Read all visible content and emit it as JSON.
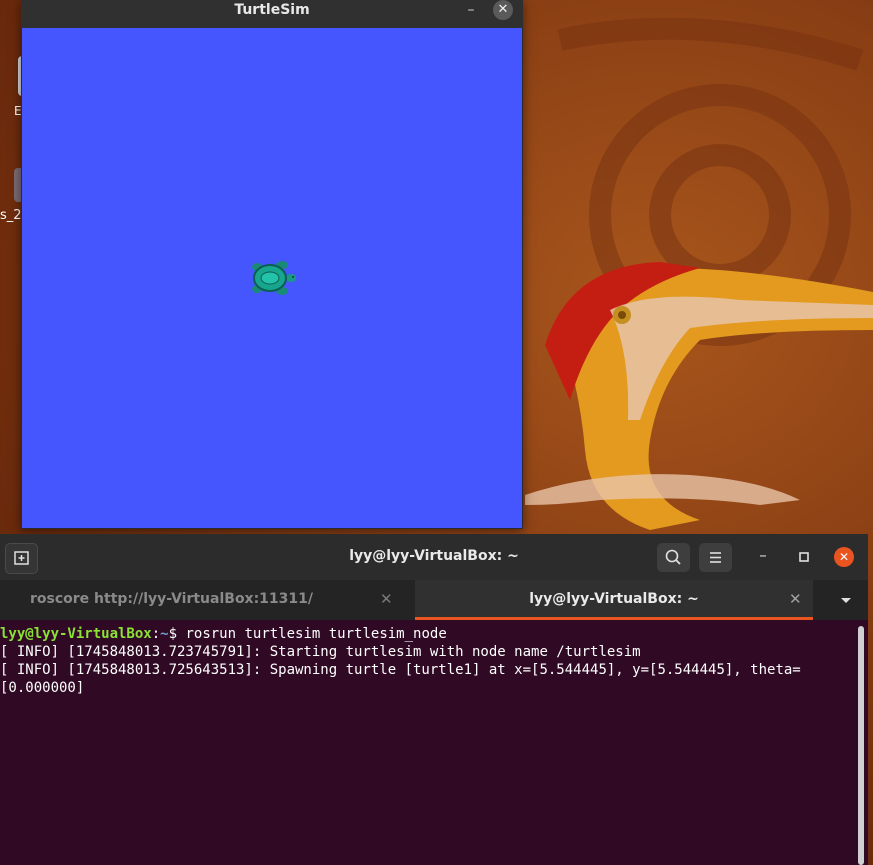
{
  "desktop": {
    "icon_label_1": "s_2",
    "icon_label_2": "E"
  },
  "turtlesim": {
    "title": "TurtleSim",
    "minimize_glyph": "–",
    "close_glyph": "✕",
    "background_color": "#4556ff",
    "turtle_icon": "turtle-icon"
  },
  "terminal": {
    "title": "lyy@lyy-VirtualBox: ~",
    "new_tab_icon": "new-tab-icon",
    "search_icon": "search-icon",
    "menu_icon": "hamburger-menu-icon",
    "minimize_glyph": "–",
    "close_glyph": "✕",
    "tabs": [
      {
        "label": "roscore http://lyy-VirtualBox:11311/",
        "active": false
      },
      {
        "label": "lyy@lyy-VirtualBox: ~",
        "active": true
      }
    ],
    "tab_close_glyph": "✕",
    "prompt": {
      "user": "lyy@lyy-VirtualBox",
      "sep": ":",
      "path": "~",
      "symbol": "$",
      "command": " rosrun turtlesim turtlesim_node"
    },
    "output": [
      "[ INFO] [1745848013.723745791]: Starting turtlesim with node name /turtlesim",
      "[ INFO] [1745848013.725643513]: Spawning turtle [turtle1] at x=[5.544445], y=[5.544445], theta=",
      "[0.000000]"
    ],
    "accent_color": "#e95420",
    "background_color": "#300a24"
  }
}
